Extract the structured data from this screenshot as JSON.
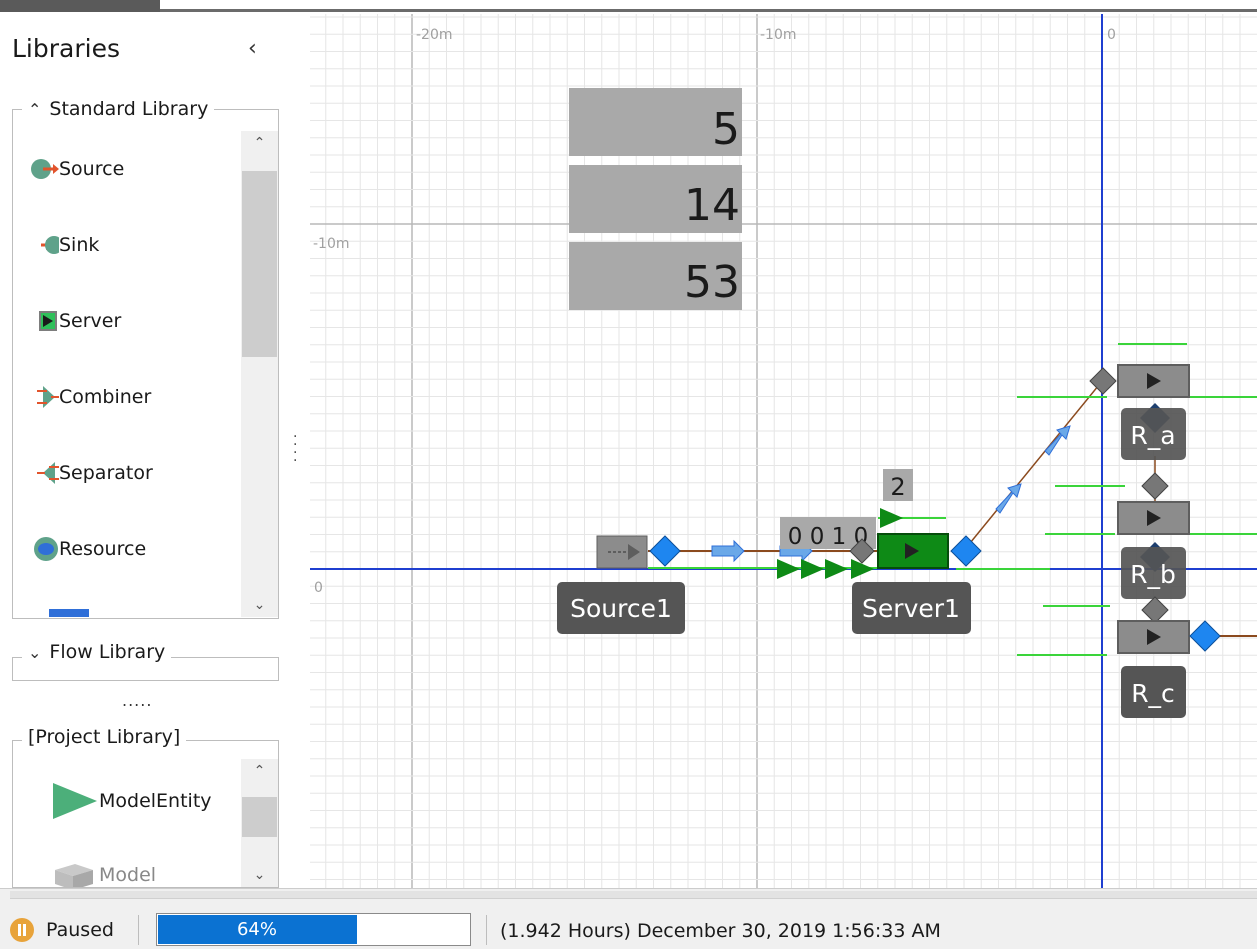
{
  "sidebar": {
    "title": "Libraries",
    "standard_library": {
      "label": "Standard Library",
      "items": [
        {
          "label": "Source",
          "icon": "source-icon"
        },
        {
          "label": "Sink",
          "icon": "sink-icon"
        },
        {
          "label": "Server",
          "icon": "server-icon"
        },
        {
          "label": "Combiner",
          "icon": "combiner-icon"
        },
        {
          "label": "Separator",
          "icon": "separator-icon"
        },
        {
          "label": "Resource",
          "icon": "resource-icon"
        }
      ]
    },
    "flow_library": {
      "label": "Flow Library"
    },
    "divider_dots": ".....",
    "project_library": {
      "label": "[Project Library]",
      "items": [
        {
          "label": "ModelEntity",
          "icon": "model-entity-icon"
        },
        {
          "label": "Model",
          "icon": "model-icon"
        }
      ]
    }
  },
  "canvas": {
    "axis_labels": [
      "-20m",
      "-10m",
      "0",
      "-10m",
      "0"
    ],
    "counters": [
      "5",
      "14",
      "53"
    ],
    "server_queue_count": "2",
    "server_status_digits": "0 0 1 0",
    "objects": {
      "source": "Source1",
      "server": "Server1",
      "r_a": "R_a",
      "r_b": "R_b",
      "r_c": "R_c"
    },
    "colors": {
      "grid_minor": "#e6e6e6",
      "grid_major": "#b8b8b8",
      "axis": "#1f3fd0",
      "server_busy": "#0e8a16",
      "node": "#1e86f0",
      "label_bg": "#555555",
      "path": "#8b4a1e",
      "queue_line": "#3ad43a"
    }
  },
  "statusbar": {
    "state": "Paused",
    "progress_value": 64,
    "progress_label": "64%",
    "time": "(1.942 Hours) December 30, 2019 1:56:33 AM"
  }
}
